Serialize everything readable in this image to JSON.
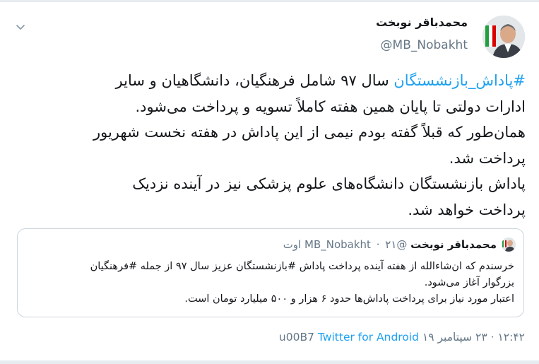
{
  "tweet": {
    "author_name": "محمدباقر نوبخت",
    "author_handle": "@MB_Nobakht",
    "body_hashtag": "#پاداش_بازنشستگان",
    "body_line1_rest": " سال ۹۷ شامل فرهنگیان، دانشگاهیان و سایر",
    "body_line2": "ادارات دولتی تا پایان همین هفته کاملاً تسویه و پرداخت می‌شود.",
    "body_line3": "همان‌طور که قبلاً گفته بودم نیمی از این پاداش در هفته نخست شهریور",
    "body_line4": "پرداخت شد.",
    "body_line5": "پاداش بازنشستگان دانشگاه‌های علوم پزشکی نیز در آینده نزدیک",
    "body_line6": "پرداخت خواهد شد."
  },
  "quoted_tweet": {
    "author_name": "محمدباقر نوبخت",
    "author_handle": "@MB_Nobakht",
    "separator": "·",
    "date": "۲۱ اوت",
    "line1": "خرسندم که ان‌شاءالله از هفته آینده پرداخت پاداش #بازنشستگان عزیز سال ۹۷ از جمله #فرهنگیان",
    "line2": "بزرگوار آغاز می‌شود.",
    "line3": "اعتبار مورد نیاز برای پرداخت پاداش‌ها حدود ۶ هزار و ۵۰۰ میلیارد تومان است."
  },
  "meta": {
    "time": "۱۲:۴۲",
    "dot": "·",
    "date": "۲۳ سپتامبر ۱۹",
    "separator": "u00B7",
    "source": "Twitter for Android"
  },
  "icons": {
    "menu": "chevron-down-icon"
  },
  "colors": {
    "link": "#1da1f2",
    "secondary_text": "#657786",
    "border": "#ccd6dd"
  }
}
